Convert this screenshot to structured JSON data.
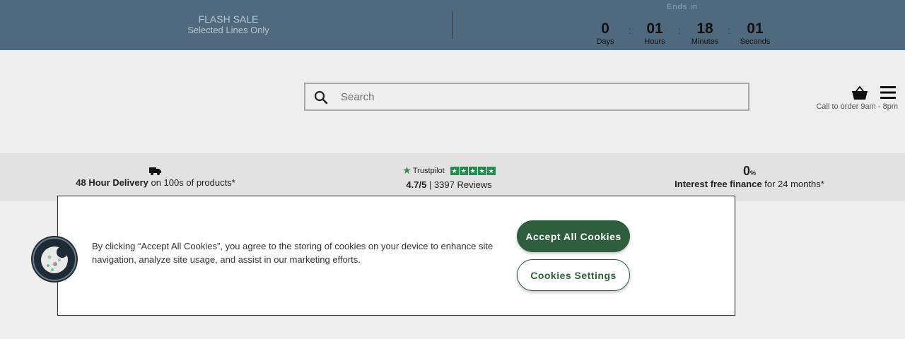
{
  "flash_sale": {
    "title": "FLASH SALE",
    "subtitle": "Selected Lines Only",
    "ends_label": "Ends in",
    "countdown": [
      {
        "value": "0",
        "label": "Days"
      },
      {
        "value": "01",
        "label": "Hours"
      },
      {
        "value": "18",
        "label": "Minutes"
      },
      {
        "value": "01",
        "label": "Seconds"
      }
    ],
    "separator": ":"
  },
  "header": {
    "search_placeholder": "Search",
    "call_text": "Call to order 9am - 8pm",
    "icons": [
      "search-icon",
      "basket-icon",
      "menu-icon"
    ]
  },
  "usp": {
    "delivery_bold": "48 Hour Delivery",
    "delivery_rest": " on 100s of products*",
    "trustpilot_name": "Trustpilot",
    "rating_bold": "4.7/5",
    "rating_rest": " | 3397 Reviews",
    "finance_big": "0",
    "finance_pct": "%",
    "finance_bold": "Interest free finance",
    "finance_rest": " for 24 months*"
  },
  "cookie_banner": {
    "text": "By clicking “Accept All Cookies”, you agree to the storing of cookies on your device to enhance site navigation, analyze site usage, and assist in our marketing efforts.",
    "accept_label": "Accept All Cookies",
    "settings_label": "Cookies Settings"
  },
  "colors": {
    "flash_bar": "#4f6a7e",
    "accent_green": "#2e5e3e",
    "trustpilot_green": "#2a8a52"
  }
}
